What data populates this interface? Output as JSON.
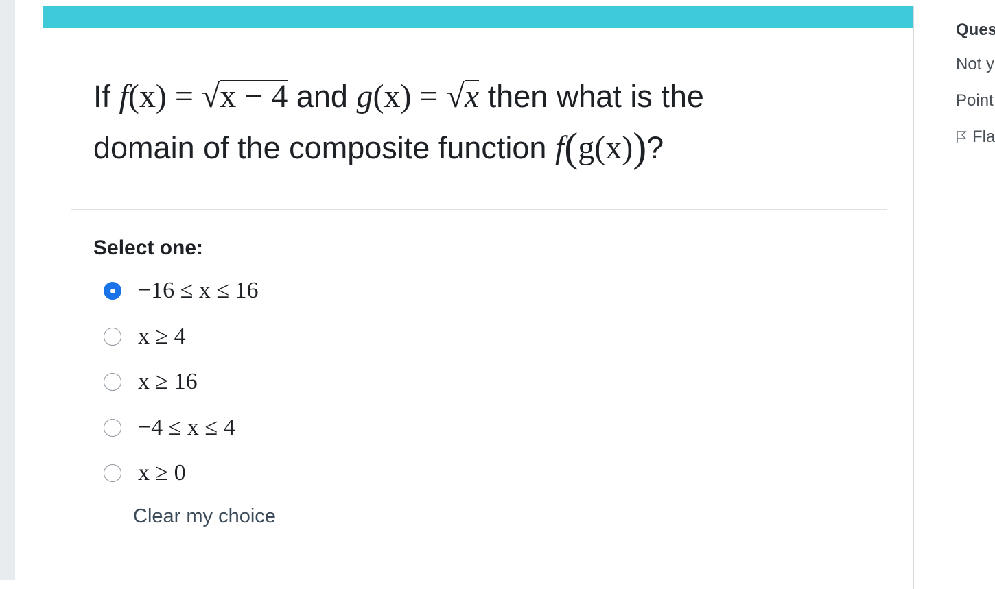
{
  "question": {
    "text_if": "If",
    "f_expr_name": "f",
    "f_expr_arg": "(x)",
    "equals": " = ",
    "f_radicand": "x − 4",
    "and": " and ",
    "g_expr_name": "g",
    "g_expr_arg": "(x)",
    "g_radicand": "x",
    "then": " then what is the",
    "line2": "domain of the composite function ",
    "composite_f": "f",
    "composite_inner": "g(x)",
    "qmark": "?"
  },
  "prompt": "Select one:",
  "answers": [
    {
      "label": "−16 ≤ x ≤ 16",
      "selected": true
    },
    {
      "label": "x ≥ 4",
      "selected": false
    },
    {
      "label": "x ≥ 16",
      "selected": false
    },
    {
      "label": "−4 ≤ x ≤ 4",
      "selected": false
    },
    {
      "label": "x ≥ 0",
      "selected": false
    }
  ],
  "clear_choice": "Clear my choice",
  "right_panel": {
    "title": "Ques",
    "status": "Not y",
    "points": "Point",
    "flag": "Fla"
  },
  "colors": {
    "accent_bar": "#3ecad8",
    "radio_selected": "#1a73e8",
    "text": "#1d2125",
    "link": "#3c4b5a"
  }
}
